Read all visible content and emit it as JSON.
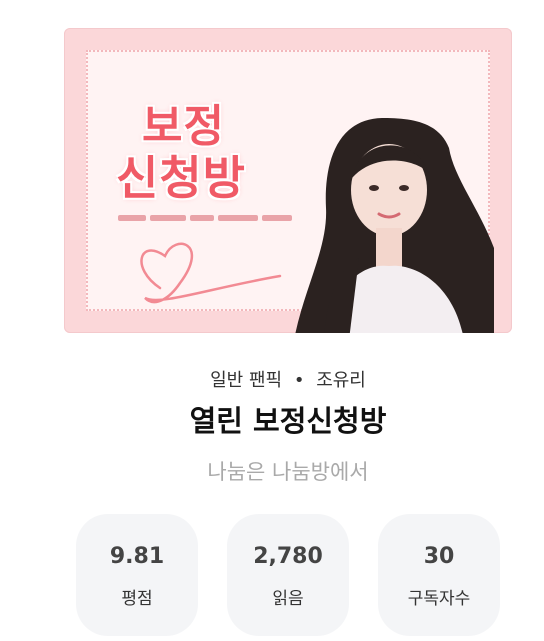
{
  "cover": {
    "title_line1": "보정",
    "title_line2": "신청방",
    "colors": {
      "background": "#fbd7d9",
      "accent": "#f05a66"
    }
  },
  "info": {
    "genre": "일반 팬픽",
    "separator": "•",
    "author": "조유리",
    "title": "열린 보정신청방",
    "subtitle": "나눔은 나눔방에서"
  },
  "stats": [
    {
      "value": "9.81",
      "label": "평점"
    },
    {
      "value": "2,780",
      "label": "읽음"
    },
    {
      "value": "30",
      "label": "구독자수"
    }
  ]
}
